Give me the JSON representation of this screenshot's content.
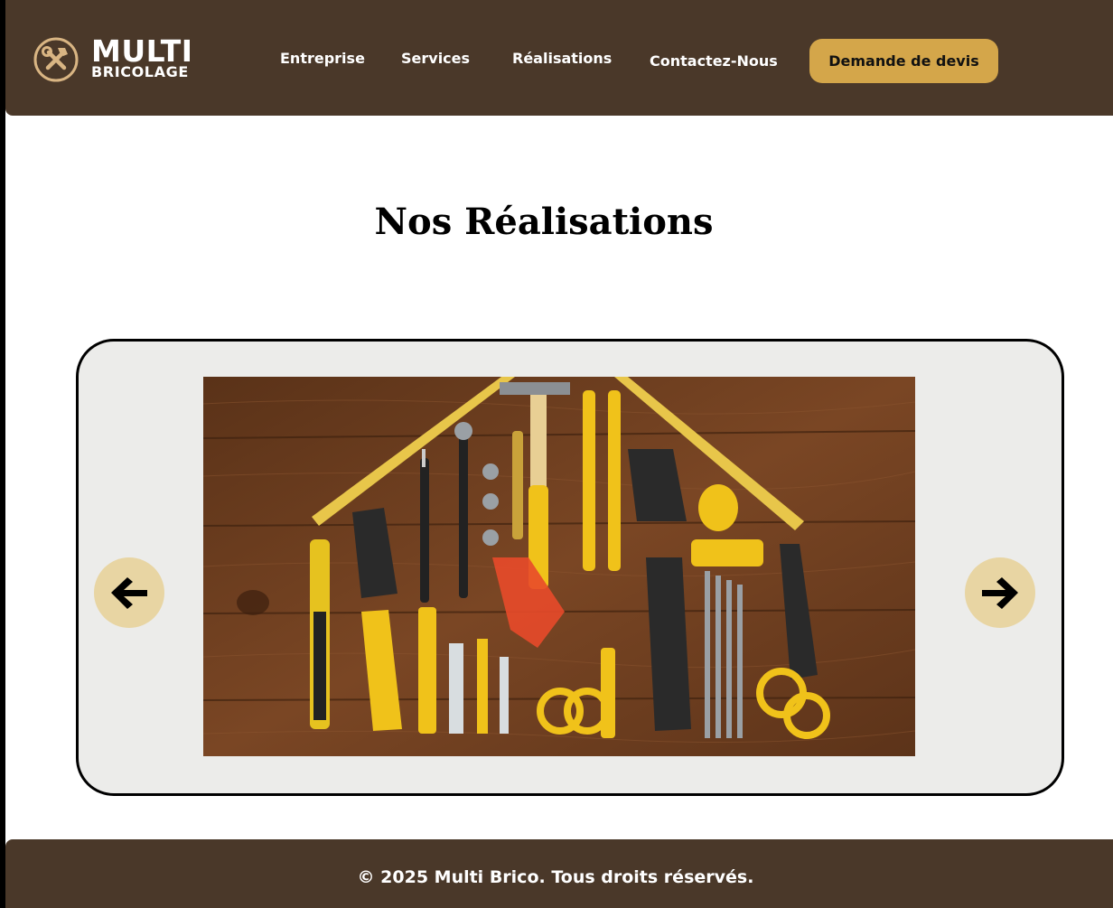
{
  "header": {
    "logo": {
      "line1": "MULTI",
      "line2": "BRICOLAGE",
      "icon": "hammer-wrench-icon"
    },
    "nav": [
      {
        "label": "Entreprise"
      },
      {
        "label": "Services"
      },
      {
        "label": "Réalisations"
      },
      {
        "label": "Contactez-Nous"
      }
    ],
    "cta_label": "Demande de devis"
  },
  "main": {
    "title": "Nos Réalisations",
    "carousel": {
      "prev_icon": "arrow-left-icon",
      "next_icon": "arrow-right-icon",
      "image_subject": "tools-arranged-as-house"
    }
  },
  "footer": {
    "text": "© 2025 Multi Brico. Tous droits réservés."
  },
  "colors": {
    "header_bg": "#4a3829",
    "accent": "#d4a64a",
    "arrow_bg": "#e8d5a3",
    "carousel_bg": "#ececea",
    "logo_badge": "#d9b583"
  }
}
